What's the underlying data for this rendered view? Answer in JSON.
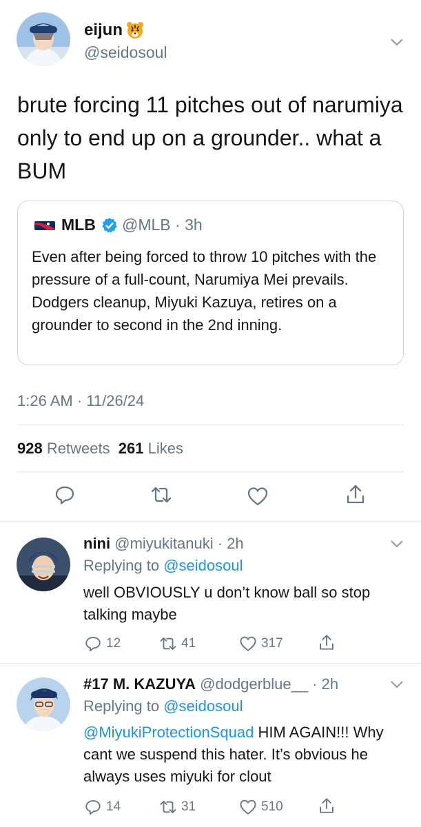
{
  "main_tweet": {
    "name": "eijun",
    "handle": "@seidosoul",
    "text": "brute forcing 11 pitches out of narumiya only to end up on a grounder.. what a BUM",
    "timestamp": "1:26 AM · 11/26/24",
    "retweets_count": "928",
    "retweets_label": "Retweets",
    "likes_count": "261",
    "likes_label": "Likes"
  },
  "quoted_tweet": {
    "name": "MLB",
    "handle": "@MLB · 3h",
    "text": "Even after being forced to throw 10 pitches with the pressure of a full-count, Narumiya Mei prevails. Dodgers cleanup, Miyuki Kazuya, retires on a grounder to second in the 2nd inning."
  },
  "replies": [
    {
      "name": "nini",
      "handle": "@miyukitanuki · 2h",
      "replying_prefix": "Replying to",
      "replying_to": "@seidosoul",
      "mention": "",
      "text": "well OBVIOUSLY u don’t know ball so stop talking maybe",
      "reply_count": "12",
      "retweet_count": "41",
      "like_count": "317"
    },
    {
      "name": "#17 M. KAZUYA",
      "handle": "@dodgerblue__ · 2h",
      "replying_prefix": "Replying to",
      "replying_to": "@seidosoul",
      "mention": "@MiyukiProtectionSquad",
      "text": " HIM AGAIN!!! Why cant we suspend this hater. It’s obvious he always uses miyuki for clout",
      "reply_count": "14",
      "retweet_count": "31",
      "like_count": "510"
    }
  ],
  "colors": {
    "link_blue": "#1b95e0",
    "secondary_grey": "#657786",
    "divider": "#e1e8ed",
    "verified_blue": "#1da1f2"
  }
}
